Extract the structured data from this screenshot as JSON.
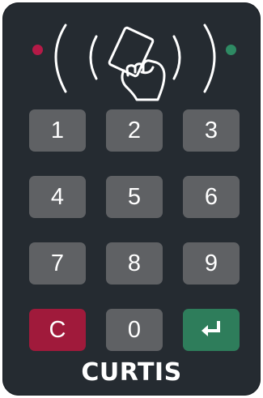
{
  "leds": {
    "left_color": "#b51a47",
    "right_color": "#2e8a63",
    "left_icon": "red-led-icon",
    "right_icon": "green-led-icon"
  },
  "reader": {
    "icon": "contactless-card-reader-icon",
    "stroke_color": "#ffffff"
  },
  "keypad": {
    "keys": [
      {
        "label": "1"
      },
      {
        "label": "2"
      },
      {
        "label": "3"
      },
      {
        "label": "4"
      },
      {
        "label": "5"
      },
      {
        "label": "6"
      },
      {
        "label": "7"
      },
      {
        "label": "8"
      },
      {
        "label": "9"
      },
      {
        "label": "C"
      },
      {
        "label": "0"
      },
      {
        "label": "",
        "icon": "enter-return-icon"
      }
    ],
    "key_color": "#5f6164",
    "clear_color": "#a01a3b",
    "enter_color": "#2e7d5b"
  },
  "brand": {
    "name": "CURTIS"
  }
}
